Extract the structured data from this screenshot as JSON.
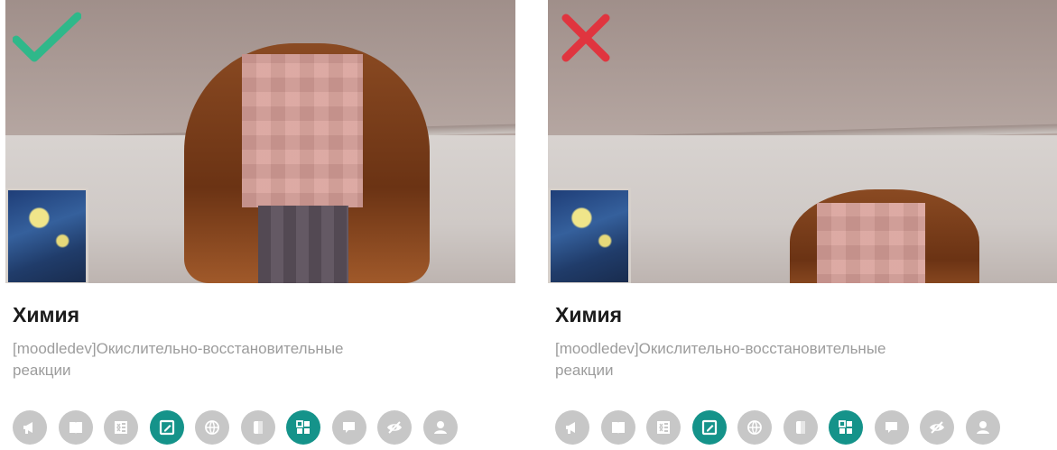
{
  "cards": [
    {
      "status": "accepted",
      "title": "Химия",
      "subtitle_line1": "[moodledev]Окислительно-восстановительные",
      "subtitle_line2": "реакции",
      "mark_color": "#2fb88a",
      "icons": [
        {
          "name": "megaphone-icon",
          "active": false
        },
        {
          "name": "book-icon",
          "active": false
        },
        {
          "name": "spreadsheet-icon",
          "active": false
        },
        {
          "name": "edit-icon",
          "active": true
        },
        {
          "name": "globe-icon",
          "active": false
        },
        {
          "name": "document-icon",
          "active": false
        },
        {
          "name": "grid-icon",
          "active": true
        },
        {
          "name": "chat-icon",
          "active": false
        },
        {
          "name": "eye-slash-icon",
          "active": false
        },
        {
          "name": "user-icon",
          "active": false
        }
      ]
    },
    {
      "status": "rejected",
      "title": "Химия",
      "subtitle_line1": "[moodledev]Окислительно-восстановительные",
      "subtitle_line2": "реакции",
      "mark_color": "#e0353f",
      "icons": [
        {
          "name": "megaphone-icon",
          "active": false
        },
        {
          "name": "book-icon",
          "active": false
        },
        {
          "name": "spreadsheet-icon",
          "active": false
        },
        {
          "name": "edit-icon",
          "active": true
        },
        {
          "name": "globe-icon",
          "active": false
        },
        {
          "name": "document-icon",
          "active": false
        },
        {
          "name": "grid-icon",
          "active": true
        },
        {
          "name": "chat-icon",
          "active": false
        },
        {
          "name": "eye-slash-icon",
          "active": false
        },
        {
          "name": "user-icon",
          "active": false
        }
      ]
    }
  ],
  "colors": {
    "icon_inactive": "#c7c7c7",
    "icon_active": "#15938a"
  }
}
